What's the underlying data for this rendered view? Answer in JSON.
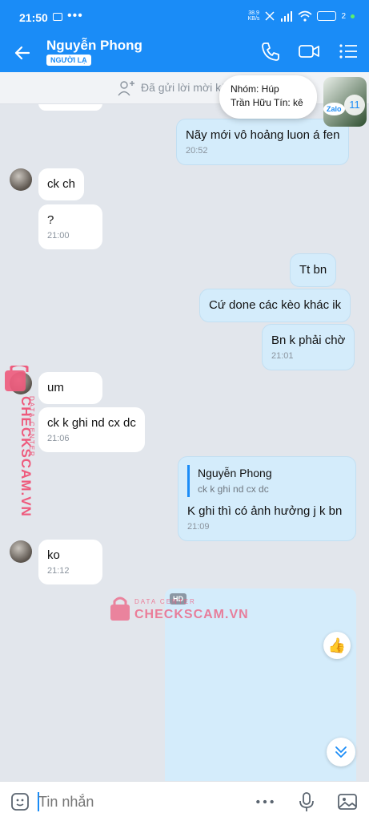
{
  "status": {
    "time": "21:50",
    "dots": "•••",
    "netspeed_top": "38.9",
    "netspeed_bottom": "KB/s",
    "battery": "2"
  },
  "header": {
    "name": "Nguyễn Phong",
    "badge": "NGƯỜI LẠ"
  },
  "invite": {
    "text": "Đã gửi lời mời kết bạn"
  },
  "notification": {
    "line1": "Nhóm: Húp",
    "line2": "Trần Hữu Tín: kê",
    "count": "11",
    "app": "Zalo"
  },
  "messages": [
    {
      "text": "Nãy mới vô hoảng luon á fen",
      "time": "20:52"
    },
    {
      "text": "ck ch"
    },
    {
      "text": "?",
      "time": "21:00"
    },
    {
      "text": "Tt bn"
    },
    {
      "text": "Cứ done các kèo khác ik"
    },
    {
      "text": "Bn k phải chờ",
      "time": "21:01"
    },
    {
      "text": "um"
    },
    {
      "text": "ck k ghi nd cx dc",
      "time": "21:06"
    },
    {
      "reply_name": "Nguyễn Phong",
      "reply_text": "ck k ghi nd cx dc",
      "text": "K ghi thì có ảnh hưởng j k bn",
      "time": "21:09"
    },
    {
      "text": "ko",
      "time": "21:12"
    }
  ],
  "media": {
    "badge": "HD"
  },
  "watermark": {
    "small": "DATA CENTER",
    "big": "CHECKSCAM.VN"
  },
  "input": {
    "placeholder": "Tin nhắn"
  },
  "colors": {
    "primary": "#1a8cf7",
    "outgoing_bubble": "#d4ecfb",
    "background": "#e2e6ec",
    "watermark": "#ee5a7c"
  }
}
